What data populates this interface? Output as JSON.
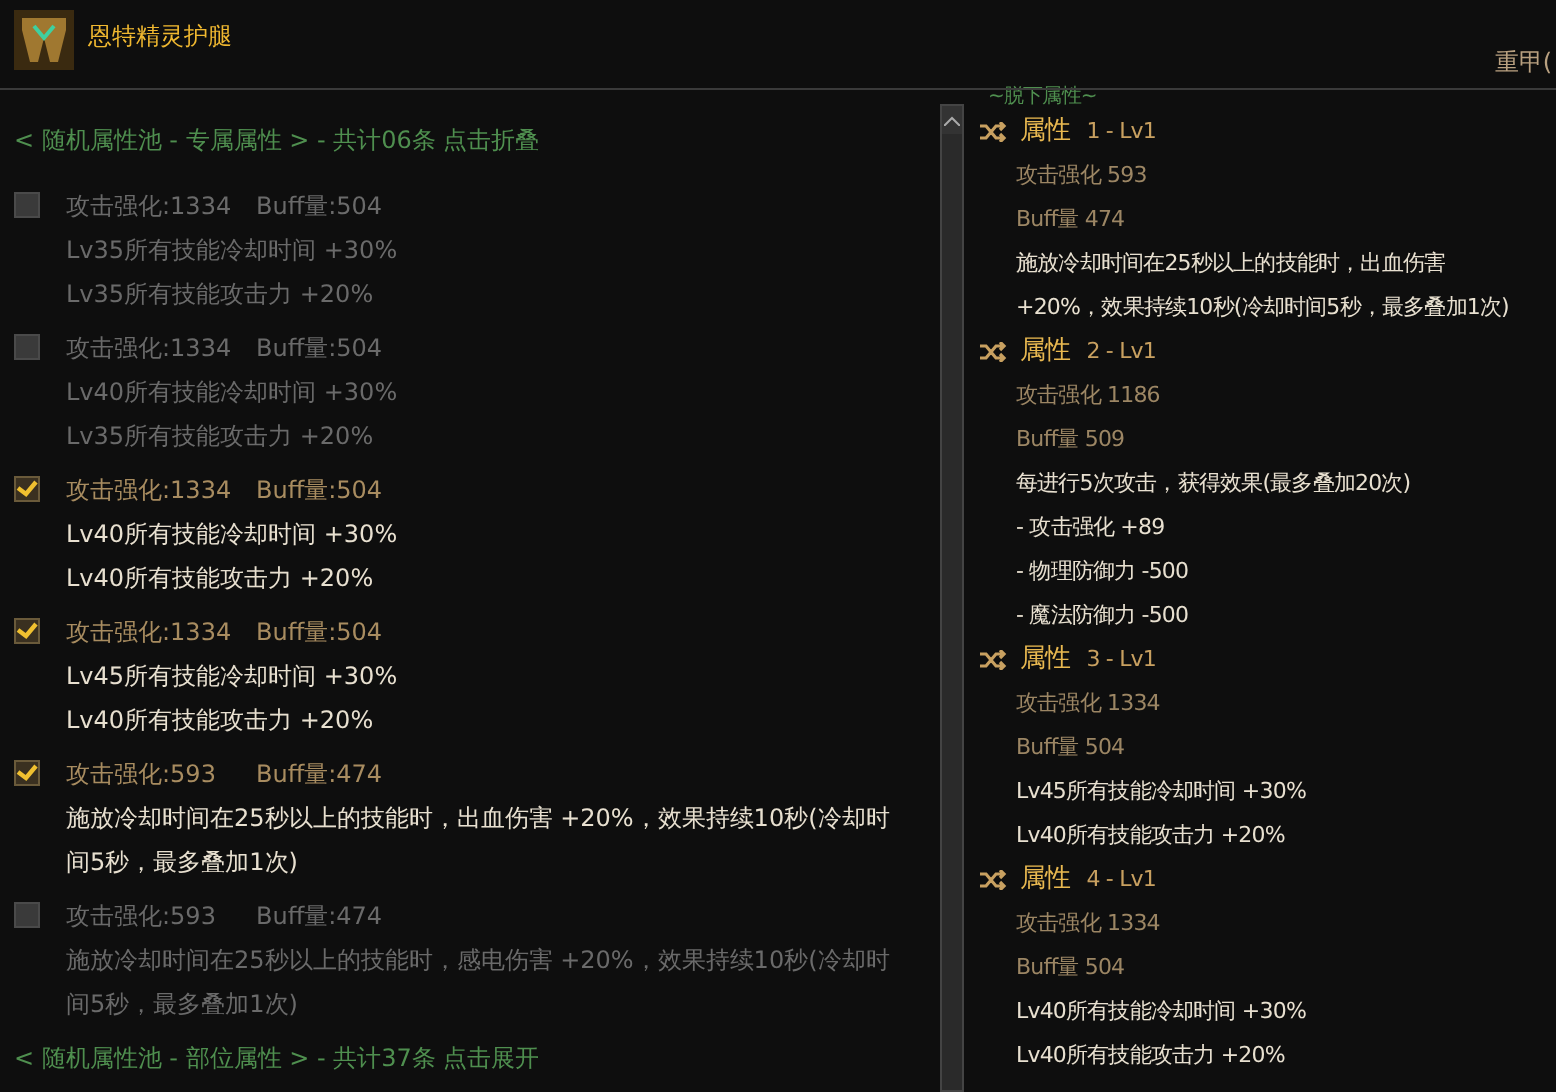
{
  "item": {
    "name": "恩特精灵护腿",
    "type": "重甲("
  },
  "left": {
    "sections": [
      {
        "header": "< 随机属性池 - 专属属性 > - 共计06条 点击折叠",
        "options": [
          {
            "checked": false,
            "attack": "攻击强化:1334",
            "buff": "Buff量:504",
            "lines": [
              "Lv35所有技能冷却时间 +30%",
              "Lv35所有技能攻击力 +20%"
            ]
          },
          {
            "checked": false,
            "attack": "攻击强化:1334",
            "buff": "Buff量:504",
            "lines": [
              "Lv40所有技能冷却时间 +30%",
              "Lv35所有技能攻击力 +20%"
            ]
          },
          {
            "checked": true,
            "attack": "攻击强化:1334",
            "buff": "Buff量:504",
            "lines": [
              "Lv40所有技能冷却时间 +30%",
              "Lv40所有技能攻击力 +20%"
            ]
          },
          {
            "checked": true,
            "attack": "攻击强化:1334",
            "buff": "Buff量:504",
            "lines": [
              "Lv45所有技能冷却时间 +30%",
              "Lv40所有技能攻击力 +20%"
            ]
          },
          {
            "checked": true,
            "attack": "攻击强化:593",
            "buff": "Buff量:474",
            "lines": [
              "施放冷却时间在25秒以上的技能时，出血伤害 +20%，效果持续10秒(冷却时间5秒，最多叠加1次)"
            ]
          },
          {
            "checked": false,
            "attack": "攻击强化:593",
            "buff": "Buff量:474",
            "lines": [
              "施放冷却时间在25秒以上的技能时，感电伤害 +20%，效果持续10秒(冷却时间5秒，最多叠加1次)"
            ]
          }
        ]
      },
      {
        "header": "< 随机属性池 - 部位属性 > - 共计37条 点击展开"
      }
    ]
  },
  "right": {
    "header": "~脱下属性~",
    "attributes": [
      {
        "label": "属性",
        "level": "1 - Lv1",
        "lines": [
          {
            "kind": "stat",
            "text": "攻击强化 593"
          },
          {
            "kind": "stat",
            "text": "Buff量 474"
          },
          {
            "kind": "effect",
            "text": "施放冷却时间在25秒以上的技能时，出血伤害"
          },
          {
            "kind": "effect",
            "text": "+20%，效果持续10秒(冷却时间5秒，最多叠加1次)"
          }
        ]
      },
      {
        "label": "属性",
        "level": "2 - Lv1",
        "lines": [
          {
            "kind": "stat",
            "text": "攻击强化 1186"
          },
          {
            "kind": "stat",
            "text": "Buff量 509"
          },
          {
            "kind": "effect",
            "text": "每进行5次攻击，获得效果(最多叠加20次)"
          },
          {
            "kind": "effect",
            "text": "- 攻击强化 +89"
          },
          {
            "kind": "effect",
            "text": "- 物理防御力 -500"
          },
          {
            "kind": "effect",
            "text": "- 魔法防御力 -500"
          }
        ]
      },
      {
        "label": "属性",
        "level": "3 - Lv1",
        "lines": [
          {
            "kind": "stat",
            "text": "攻击强化 1334"
          },
          {
            "kind": "stat",
            "text": "Buff量 504"
          },
          {
            "kind": "effect",
            "text": "Lv45所有技能冷却时间 +30%"
          },
          {
            "kind": "effect",
            "text": "Lv40所有技能攻击力 +20%"
          }
        ]
      },
      {
        "label": "属性",
        "level": "4 - Lv1",
        "lines": [
          {
            "kind": "stat",
            "text": "攻击强化 1334"
          },
          {
            "kind": "stat",
            "text": "Buff量 504"
          },
          {
            "kind": "effect",
            "text": "Lv40所有技能冷却时间 +30%"
          },
          {
            "kind": "effect",
            "text": "Lv40所有技能攻击力 +20%"
          }
        ]
      }
    ]
  }
}
